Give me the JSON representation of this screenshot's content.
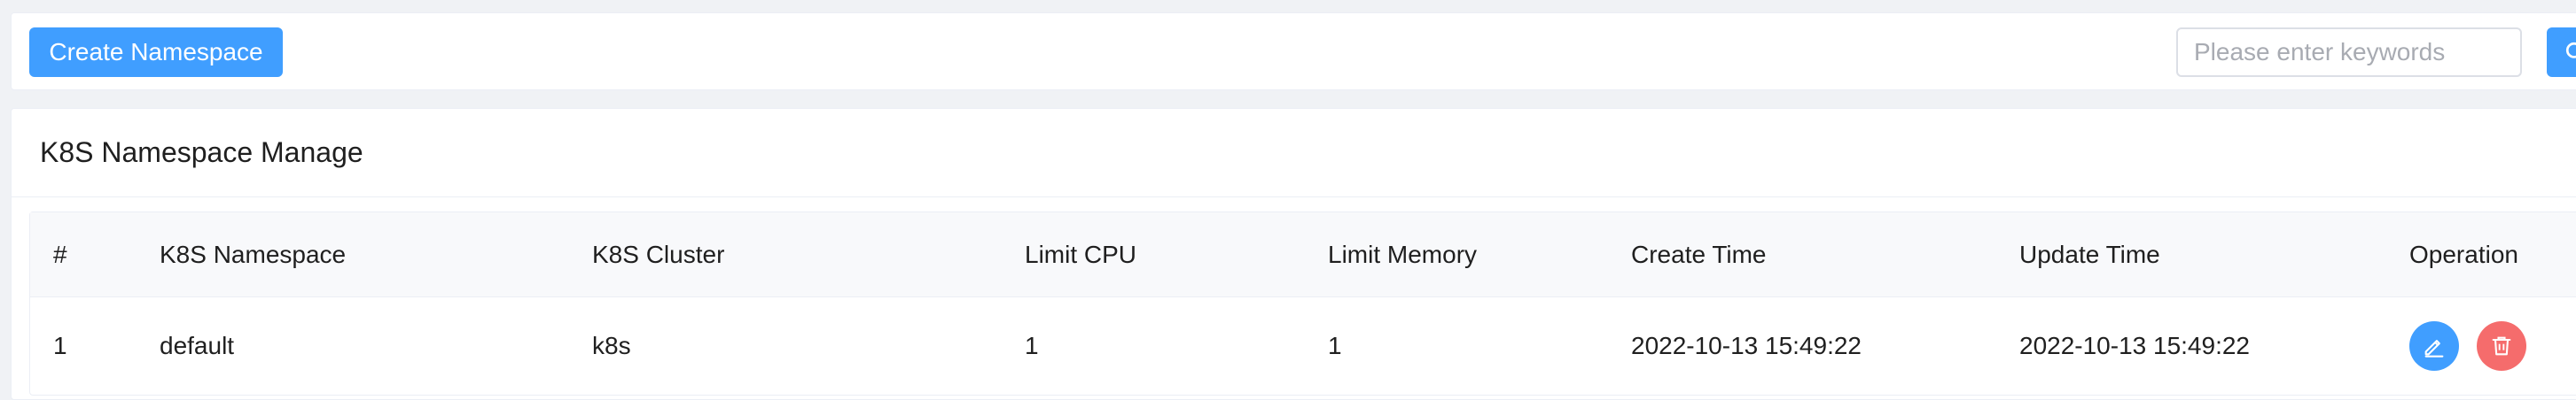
{
  "toolbar": {
    "create_label": "Create Namespace",
    "search_placeholder": "Please enter keywords",
    "search_icon": "search-icon"
  },
  "card": {
    "title": "K8S Namespace Manage"
  },
  "table": {
    "columns": [
      "#",
      "K8S Namespace",
      "K8S Cluster",
      "Limit CPU",
      "Limit Memory",
      "Create Time",
      "Update Time",
      "Operation"
    ],
    "rows": [
      {
        "index": "1",
        "namespace": "default",
        "cluster": "k8s",
        "limit_cpu": "1",
        "limit_memory": "1",
        "create_time": "2022-10-13 15:49:22",
        "update_time": "2022-10-13 15:49:22",
        "operations": [
          "edit-icon",
          "trash-icon"
        ]
      }
    ]
  },
  "colors": {
    "primary": "#409eff",
    "danger": "#f56c6c",
    "background": "#f0f2f5"
  }
}
